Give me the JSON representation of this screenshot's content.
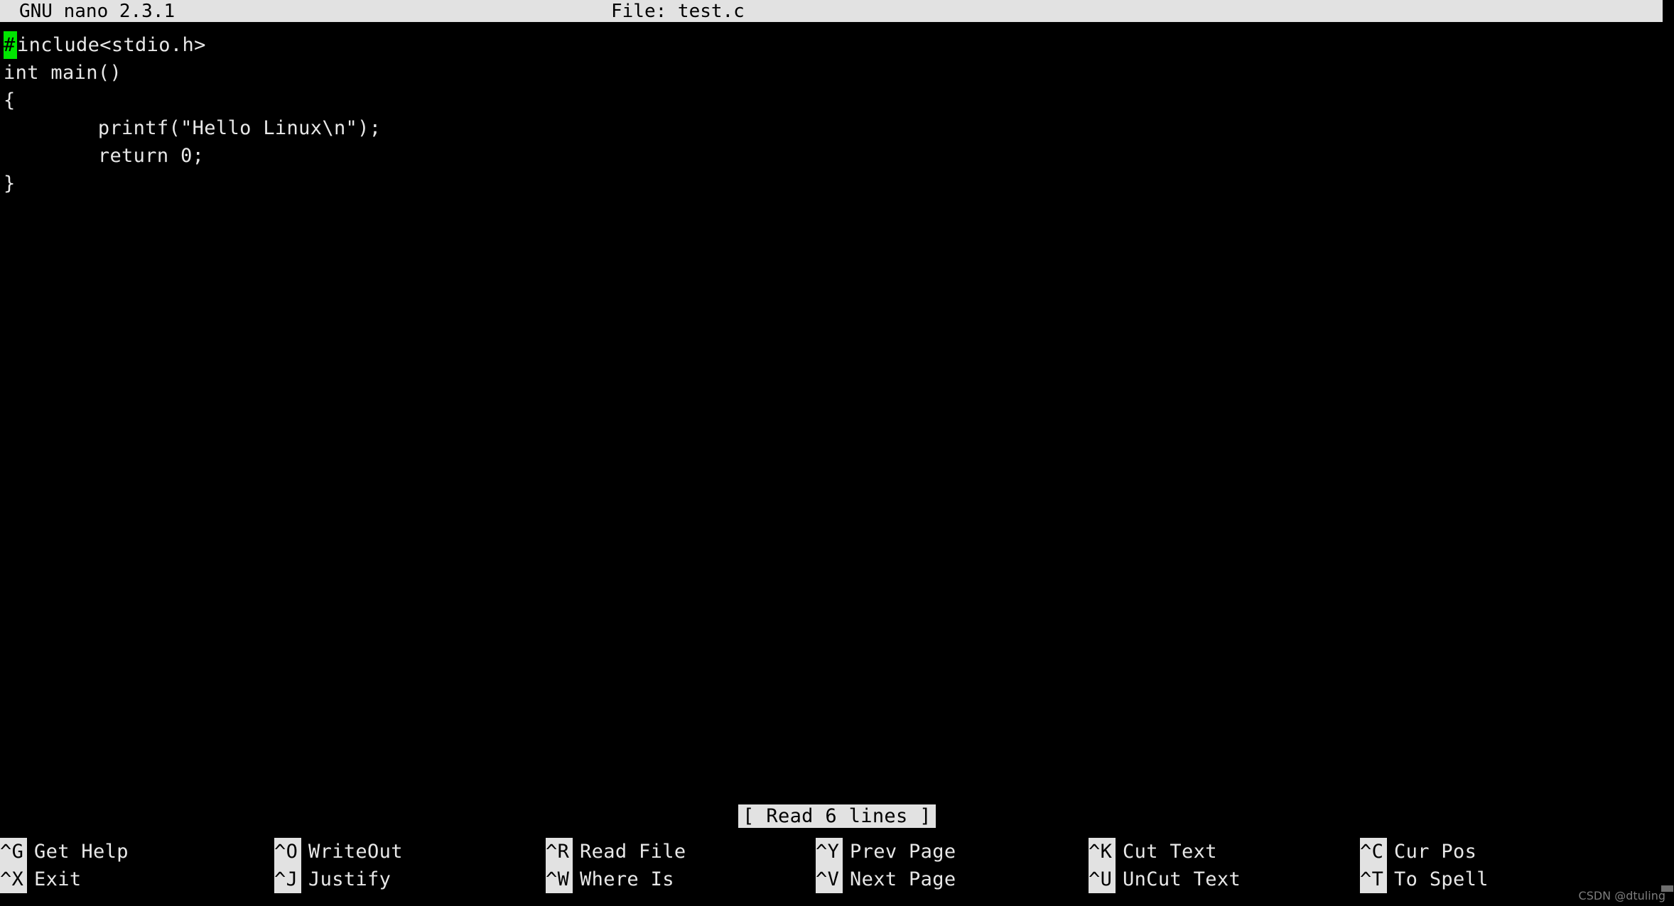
{
  "window": {
    "background_color": "#000000",
    "foreground_color": "#e8e8e8",
    "inverse_background_color": "#e2e2e2",
    "inverse_foreground_color": "#000000",
    "cursor_color": "#00e500"
  },
  "titlebar": {
    "app_label": "GNU nano 2.3.1",
    "file_label": "File: test.c",
    "filename": "test.c",
    "version": "2.3.1"
  },
  "editor": {
    "language": "c",
    "cursor": {
      "line": 1,
      "column": 1,
      "char": "#"
    },
    "lines": [
      {
        "cursor_char": "#",
        "text": "include<stdio.h>"
      },
      {
        "cursor_char": "",
        "text": "int main()"
      },
      {
        "cursor_char": "",
        "text": "{"
      },
      {
        "cursor_char": "",
        "text": "        printf(\"Hello Linux\\n\");"
      },
      {
        "cursor_char": "",
        "text": "        return 0;"
      },
      {
        "cursor_char": "",
        "text": "}"
      }
    ]
  },
  "status": {
    "message": "[ Read 6 lines ]",
    "lines_read": 6
  },
  "help": {
    "columns": [
      {
        "top": {
          "key": "^G",
          "label": "Get Help"
        },
        "bottom": {
          "key": "^X",
          "label": "Exit"
        }
      },
      {
        "top": {
          "key": "^O",
          "label": "WriteOut"
        },
        "bottom": {
          "key": "^J",
          "label": "Justify"
        }
      },
      {
        "top": {
          "key": "^R",
          "label": "Read File"
        },
        "bottom": {
          "key": "^W",
          "label": "Where Is"
        }
      },
      {
        "top": {
          "key": "^Y",
          "label": "Prev Page"
        },
        "bottom": {
          "key": "^V",
          "label": "Next Page"
        }
      },
      {
        "top": {
          "key": "^K",
          "label": "Cut Text"
        },
        "bottom": {
          "key": "^U",
          "label": "UnCut Text"
        }
      },
      {
        "top": {
          "key": "^C",
          "label": "Cur Pos"
        },
        "bottom": {
          "key": "^T",
          "label": "To Spell"
        }
      }
    ]
  },
  "watermark": {
    "text": "CSDN @dtuling"
  }
}
